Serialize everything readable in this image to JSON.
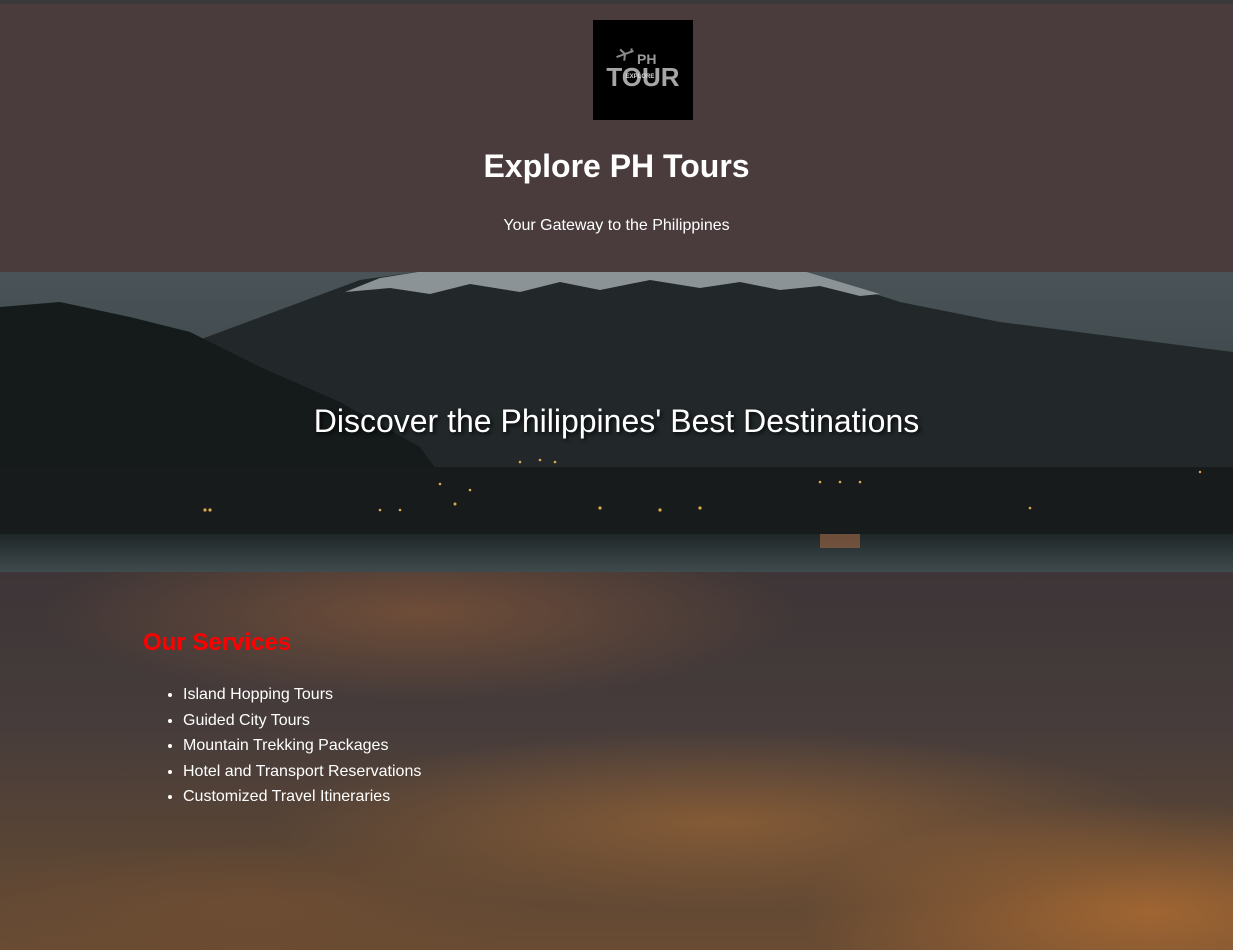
{
  "header": {
    "logo": {
      "top_text": "PH",
      "main_text": "TOUR",
      "sub_text": "EXPLORE",
      "icon": "airplane-icon"
    },
    "title": "Explore PH Tours",
    "tagline": "Your Gateway to the Philippines"
  },
  "hero": {
    "heading": "Discover the Philippines' Best Destinations"
  },
  "services": {
    "title": "Our Services",
    "items": [
      "Island Hopping Tours",
      "Guided City Tours",
      "Mountain Trekking Packages",
      "Hotel and Transport Reservations",
      "Customized Travel Itineraries"
    ]
  },
  "colors": {
    "header_bg": "#4a3c3d",
    "services_title": "#ff0000",
    "text": "#ffffff"
  }
}
